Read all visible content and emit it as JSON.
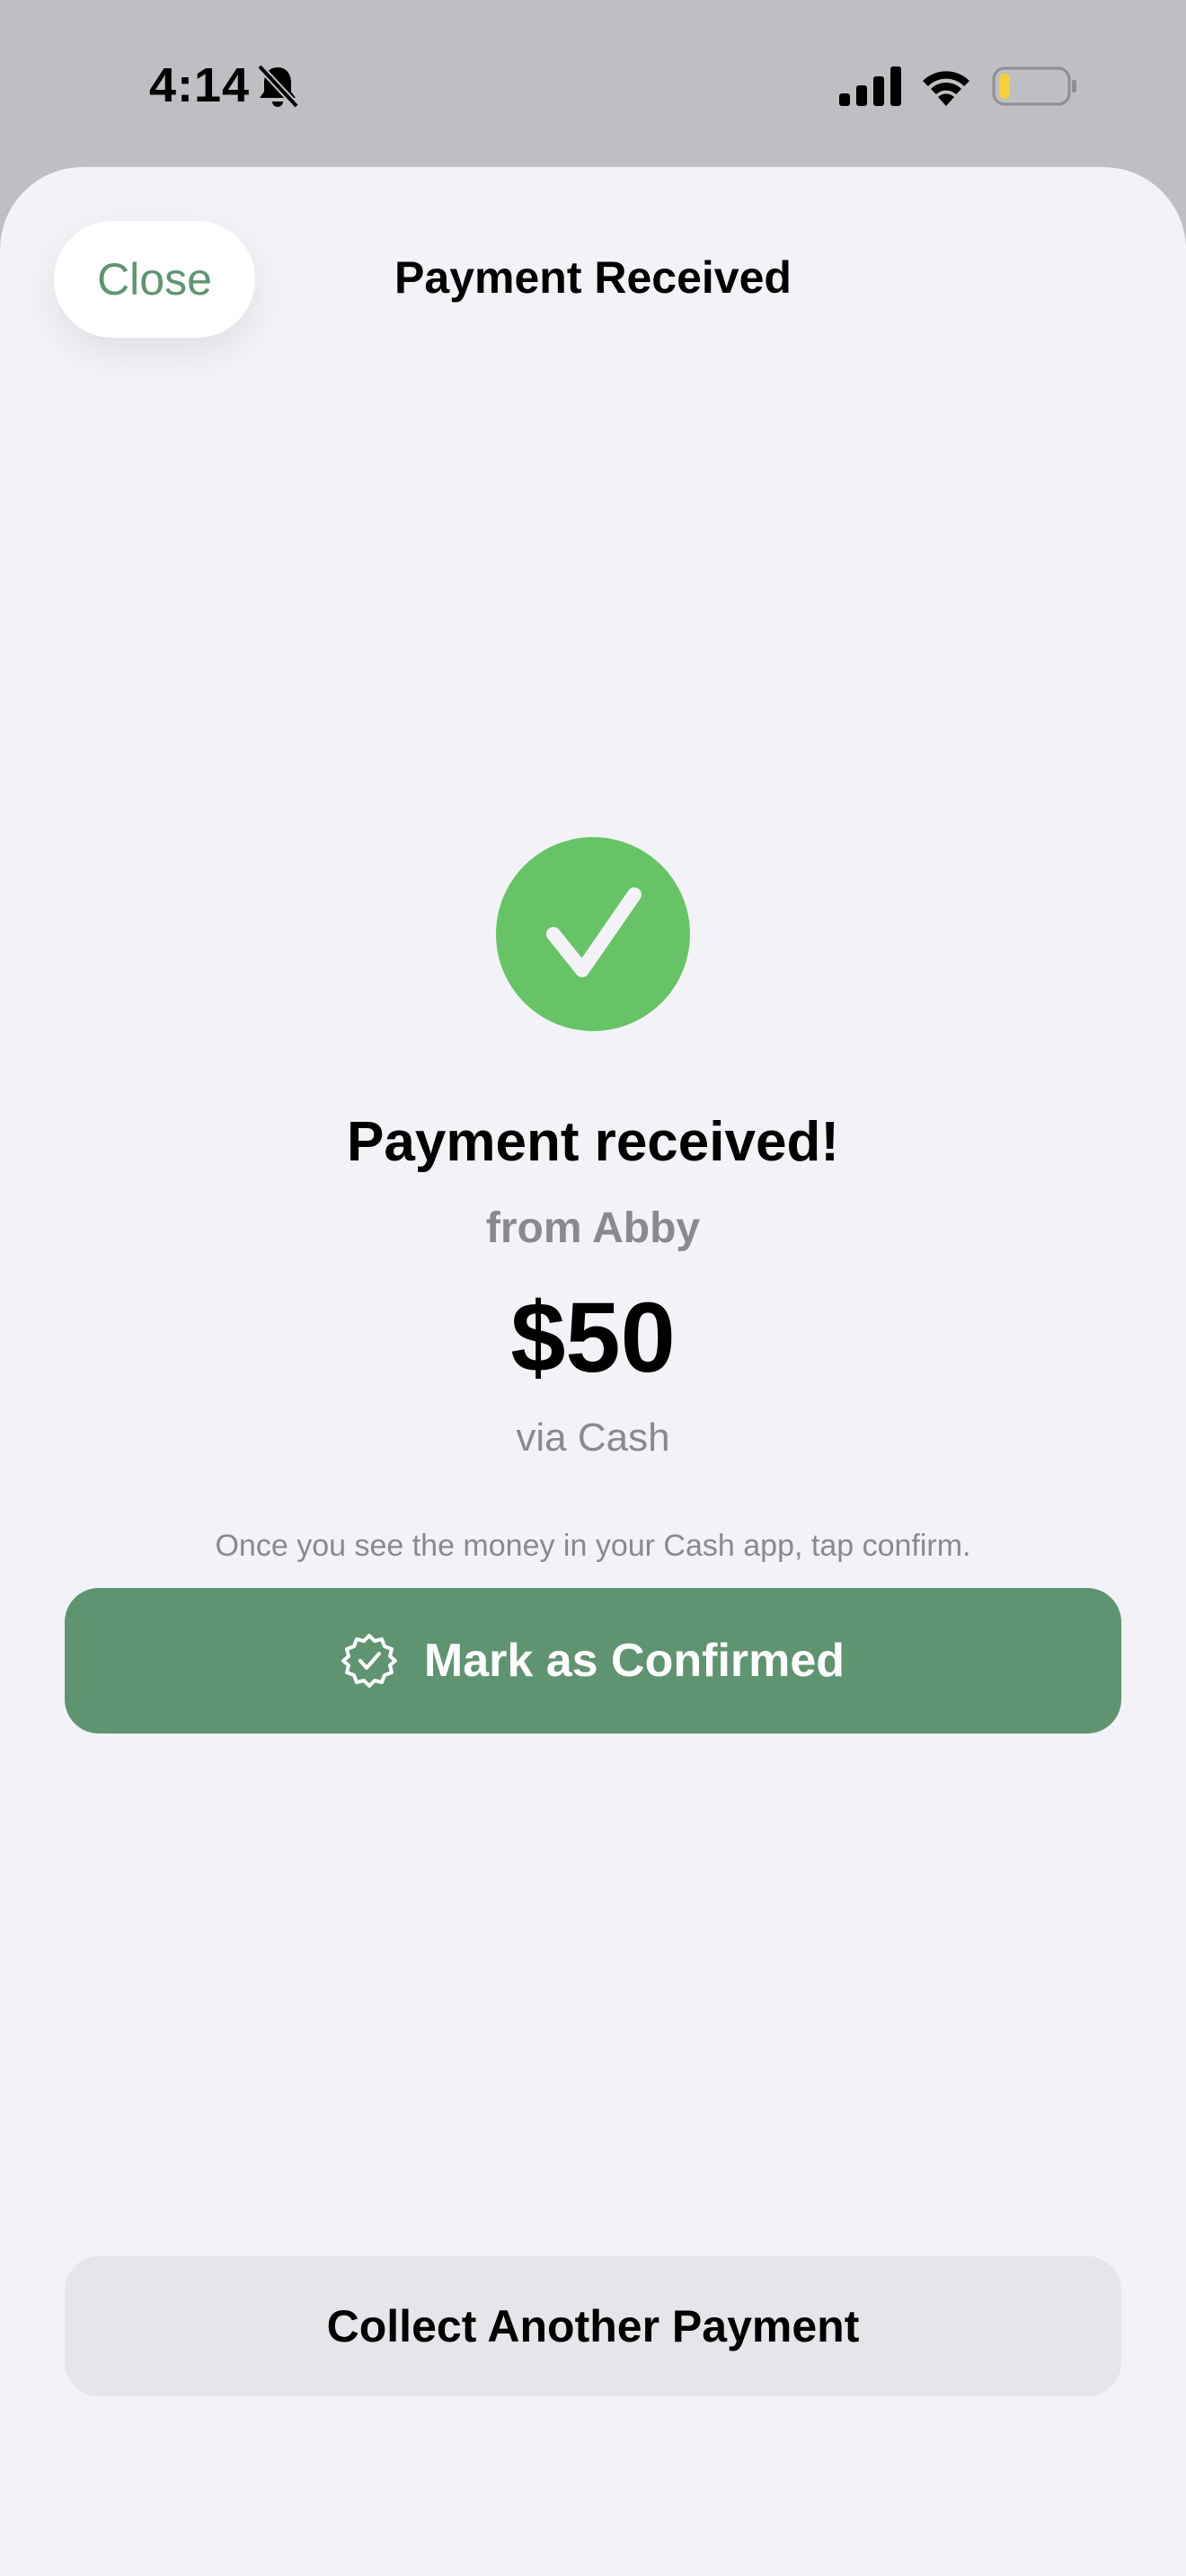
{
  "status_bar": {
    "time": "4:14",
    "icons": [
      "bell-slash-icon",
      "cellular-signal-icon",
      "wifi-icon",
      "battery-low-icon"
    ],
    "battery_color": "#f4d13b"
  },
  "nav": {
    "close_label": "Close",
    "title": "Payment Received"
  },
  "receipt": {
    "status_icon": "checkmark-circle-icon",
    "headline": "Payment received!",
    "from": "from Abby",
    "amount": "$50",
    "method": "via Cash",
    "instruction": "Once you see the money in your Cash app, tap confirm."
  },
  "actions": {
    "confirm_icon": "checkmark-seal-icon",
    "confirm_label": "Mark as Confirmed",
    "collect_label": "Collect Another Payment"
  },
  "colors": {
    "accent": "#5f9470",
    "success": "#67c466",
    "sheet_background": "#f2f2f7",
    "secondary_text": "#8a8a8e",
    "secondary_button": "#e5e5ea"
  }
}
